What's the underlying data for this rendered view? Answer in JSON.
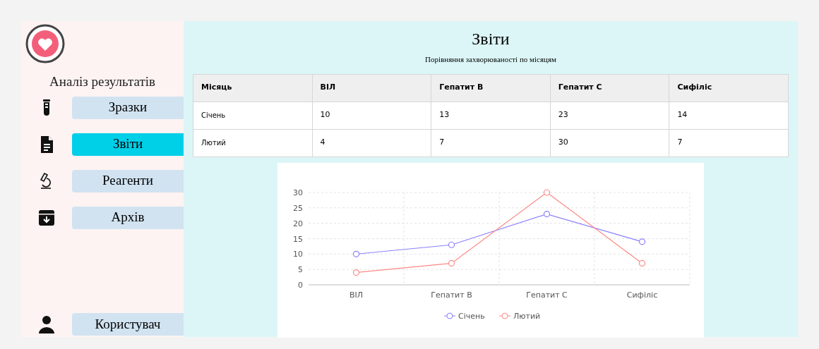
{
  "sidebar": {
    "title": "Аналіз результатів",
    "items": [
      {
        "label": "Зразки",
        "kind": "tube",
        "selected": false
      },
      {
        "label": "Звіти",
        "kind": "document",
        "selected": true
      },
      {
        "label": "Реагенти",
        "kind": "microscope",
        "selected": false
      },
      {
        "label": "Архів",
        "kind": "archive",
        "selected": false
      }
    ],
    "user": {
      "label": "Користувач",
      "kind": "user",
      "selected": false
    }
  },
  "main": {
    "title": "Звіти",
    "subtitle": "Порівняння захворюваності по місяцям",
    "table": {
      "columns": [
        "Місяць",
        "ВІЛ",
        "Гепатит B",
        "Гепатит C",
        "Сифіліс"
      ],
      "rows": [
        [
          "Січень",
          "10",
          "13",
          "23",
          "14"
        ],
        [
          "Лютий",
          "4",
          "7",
          "30",
          "7"
        ]
      ]
    },
    "chart_data": {
      "type": "line",
      "categories": [
        "ВІЛ",
        "Гепатит B",
        "Гепатит C",
        "Сифіліс"
      ],
      "series": [
        {
          "name": "Січень",
          "color": "#8b80fb",
          "marker": "circle",
          "values": [
            10,
            13,
            23,
            14
          ]
        },
        {
          "name": "Лютий",
          "color": "#fb8a85",
          "marker": "circle",
          "values": [
            4,
            7,
            30,
            7
          ]
        }
      ],
      "grid": true,
      "legend": true,
      "ylim": [
        0,
        30
      ],
      "yticks": [
        0,
        5,
        10,
        15,
        20,
        25,
        30
      ]
    }
  }
}
